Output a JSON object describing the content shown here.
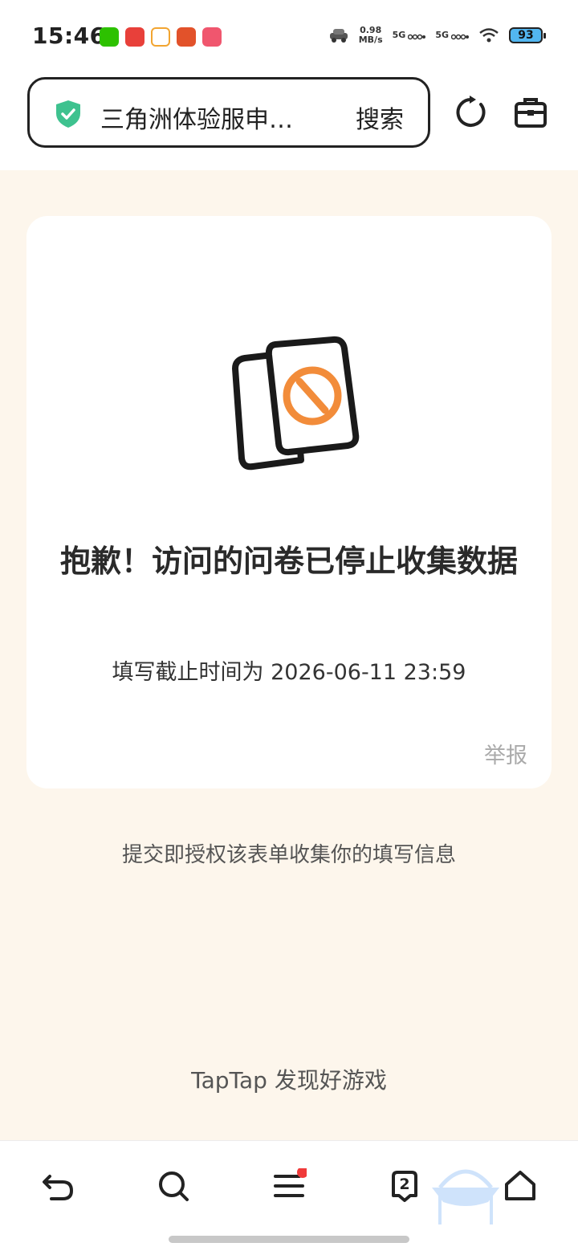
{
  "status_bar": {
    "time": "15:46",
    "speed_value": "0.98",
    "speed_unit": "MB/s",
    "sim1": "5G",
    "sim2": "5G",
    "battery": "93"
  },
  "address_bar": {
    "url_text": "三角洲体验服申…",
    "search_label": "搜索"
  },
  "card": {
    "title": "抱歉！访问的问卷已停止收集数据",
    "deadline": "填写截止时间为 2026-06-11 23:59",
    "report_label": "举报"
  },
  "notice": "提交即授权该表单收集你的填写信息",
  "footer_brand": "TapTap 发现好游戏",
  "bottom_nav": {
    "tab_count": "2"
  },
  "colors": {
    "shield": "#3ec28f",
    "content_bg": "#fdf6ec",
    "illustration_accent": "#f28c3a",
    "badge": "#f03a3a"
  }
}
